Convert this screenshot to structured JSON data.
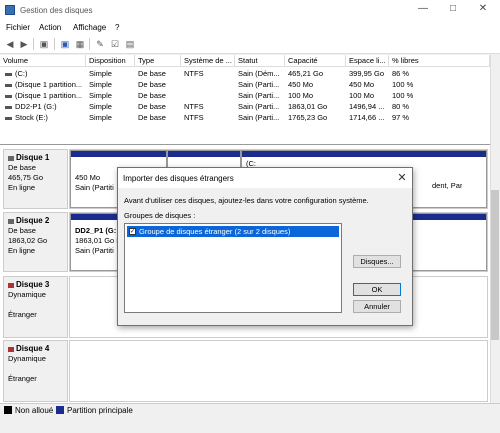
{
  "window": {
    "title": "Gestion des disques"
  },
  "menu": [
    "Fichier",
    "Action",
    "Affichage",
    "?"
  ],
  "table": {
    "headers": [
      "Volume",
      "Disposition",
      "Type",
      "Système de ...",
      "Statut",
      "Capacité",
      "Espace li...",
      "% libres"
    ],
    "rows": [
      [
        "(C:)",
        "Simple",
        "De base",
        "NTFS",
        "Sain (Dém...",
        "465,21 Go",
        "399,95 Go",
        "86 %"
      ],
      [
        "(Disque 1 partition...",
        "Simple",
        "De base",
        "",
        "Sain (Parti...",
        "450 Mo",
        "450 Mo",
        "100 %"
      ],
      [
        "(Disque 1 partition...",
        "Simple",
        "De base",
        "",
        "Sain (Parti...",
        "100 Mo",
        "100 Mo",
        "100 %"
      ],
      [
        "DD2-P1 (G:)",
        "Simple",
        "De base",
        "NTFS",
        "Sain (Parti...",
        "1863,01 Go",
        "1496,94 ...",
        "80 %"
      ],
      [
        "Stock (E:)",
        "Simple",
        "De base",
        "NTFS",
        "Sain (Parti...",
        "1765,23 Go",
        "1714,66 ...",
        "97 %"
      ]
    ]
  },
  "disks": [
    {
      "name": "Disque 1",
      "type": "De base",
      "size": "465,75 Go",
      "state": "En ligne"
    },
    {
      "name": "Disque 2",
      "type": "De base",
      "size": "1863,02 Go",
      "state": "En ligne"
    },
    {
      "name": "Disque 3",
      "type": "Dynamique",
      "size": "",
      "state": "Étranger"
    },
    {
      "name": "Disque 4",
      "type": "Dynamique",
      "size": "",
      "state": "Étranger"
    }
  ],
  "disk1_parts": [
    {
      "line1": "450 Mo",
      "line2": "Sain (Partiti"
    },
    {
      "line1": "(C:",
      "line2": "dent, Par"
    }
  ],
  "disk2_part": {
    "line1": "DD2_P1 (G:",
    "line2": "1863,01 Go N",
    "line3": "Sain (Partiti"
  },
  "legend": {
    "unallocated": "Non alloué",
    "primary": "Partition principale"
  },
  "dialog": {
    "title": "Importer des disques étrangers",
    "description": "Avant d'utiliser ces disques, ajoutez-les dans votre configuration système.",
    "group_label": "Groupes de disques :",
    "item": "Groupe de disques étranger (2 sur 2 disques)",
    "disks_button": "Disques...",
    "ok_button": "OK",
    "cancel_button": "Annuler"
  },
  "colors": {
    "primary_partition": "#1b2c8e",
    "unallocated": "#000000",
    "selection": "#0a66d9"
  }
}
